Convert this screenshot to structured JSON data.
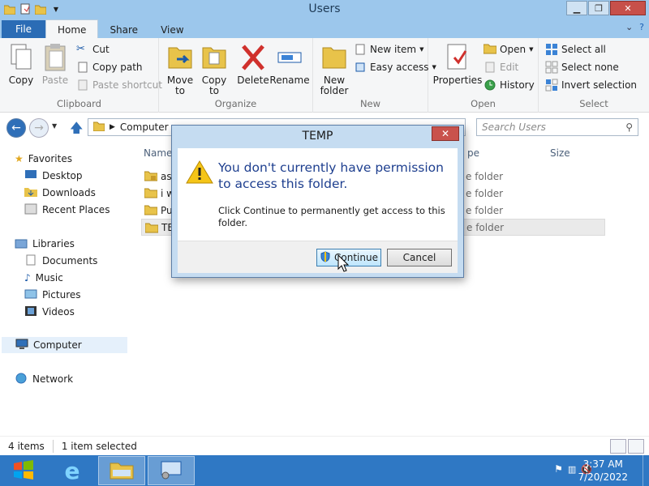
{
  "window": {
    "title": "Users"
  },
  "tabs": {
    "file": "File",
    "home": "Home",
    "share": "Share",
    "view": "View"
  },
  "ribbon": {
    "clipboard": {
      "label": "Clipboard",
      "copy": "Copy",
      "paste": "Paste",
      "cut": "Cut",
      "copy_path": "Copy path",
      "paste_shortcut": "Paste shortcut"
    },
    "organize": {
      "label": "Organize",
      "move_to_1": "Move",
      "move_to_2": "to",
      "copy_to_1": "Copy",
      "copy_to_2": "to",
      "delete": "Delete",
      "rename": "Rename"
    },
    "new": {
      "label": "New",
      "new_folder_1": "New",
      "new_folder_2": "folder",
      "new_item": "New item",
      "easy_access": "Easy access"
    },
    "open": {
      "label": "Open",
      "properties": "Properties",
      "open": "Open",
      "edit": "Edit",
      "history": "History"
    },
    "select": {
      "label": "Select",
      "select_all": "Select all",
      "select_none": "Select none",
      "invert_selection": "Invert selection"
    }
  },
  "address": {
    "path": "Computer",
    "search_placeholder": "Search Users"
  },
  "nav": {
    "favorites": "Favorites",
    "desktop": "Desktop",
    "downloads": "Downloads",
    "recent_places": "Recent Places",
    "libraries": "Libraries",
    "documents": "Documents",
    "music": "Music",
    "pictures": "Pictures",
    "videos": "Videos",
    "computer": "Computer",
    "network": "Network"
  },
  "columns": {
    "name": "Name",
    "type": "pe",
    "size": "Size"
  },
  "files": [
    {
      "name": "as",
      "type": "e folder",
      "locked": true
    },
    {
      "name": "i w",
      "type": "e folder",
      "locked": false
    },
    {
      "name": "Pu",
      "type": "e folder",
      "locked": false
    },
    {
      "name": "TE",
      "type": "e folder",
      "locked": false
    }
  ],
  "status": {
    "items": "4 items",
    "selected": "1 item selected"
  },
  "dialog": {
    "title": "TEMP",
    "main": "You don't currently have permission to access this folder.",
    "sub": "Click Continue to permanently get access to this folder.",
    "continue": "Continue",
    "cancel": "Cancel"
  },
  "taskbar": {
    "time": "3:37 AM",
    "date": "7/20/2022"
  }
}
